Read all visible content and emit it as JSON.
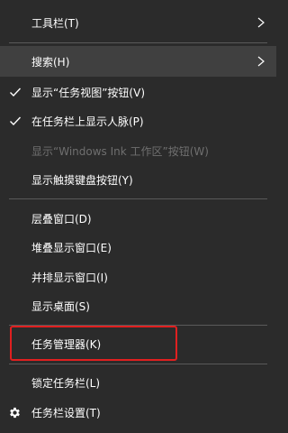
{
  "menu": {
    "items": [
      {
        "label": "工具栏(T)"
      },
      {
        "label": "搜索(H)"
      },
      {
        "label": "显示“任务视图”按钮(V)"
      },
      {
        "label": "在任务栏上显示人脉(P)"
      },
      {
        "label": "显示“Windows Ink 工作区”按钮(W)"
      },
      {
        "label": "显示触摸键盘按钮(Y)"
      },
      {
        "label": "层叠窗口(D)"
      },
      {
        "label": "堆叠显示窗口(E)"
      },
      {
        "label": "并排显示窗口(I)"
      },
      {
        "label": "显示桌面(S)"
      },
      {
        "label": "任务管理器(K)"
      },
      {
        "label": "锁定任务栏(L)"
      },
      {
        "label": "任务栏设置(T)"
      }
    ]
  },
  "colors": {
    "background": "#2b2b2b",
    "highlight": "#404040",
    "disabled_text": "#6f6f6f",
    "annotation_red": "#e02020"
  },
  "icons": {
    "submenu": "chevron-right-icon",
    "checked": "checkmark-icon",
    "settings": "gear-icon"
  }
}
